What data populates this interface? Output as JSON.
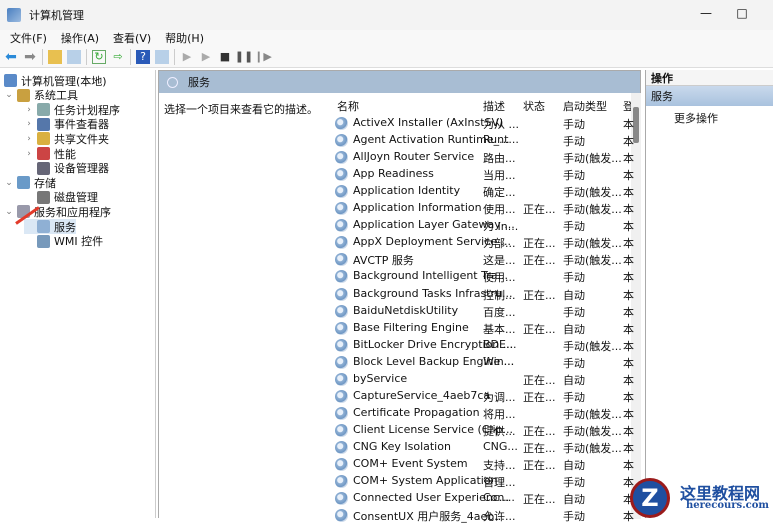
{
  "window": {
    "title": "计算机管理",
    "minimize": "—",
    "maximize": "□"
  },
  "menu": [
    "文件(F)",
    "操作(A)",
    "查看(V)",
    "帮助(H)"
  ],
  "tree": [
    {
      "label": "计算机管理(本地)",
      "level": 0,
      "chevron": "",
      "color": "#5a8ac8"
    },
    {
      "label": "系统工具",
      "level": 0,
      "chevron": "⌄",
      "color": "#c9a040"
    },
    {
      "label": "任务计划程序",
      "level": 1,
      "chevron": "›",
      "color": "#8aa"
    },
    {
      "label": "事件查看器",
      "level": 1,
      "chevron": "›",
      "color": "#5577aa"
    },
    {
      "label": "共享文件夹",
      "level": 1,
      "chevron": "›",
      "color": "#d9b040"
    },
    {
      "label": "性能",
      "level": 1,
      "chevron": "›",
      "color": "#c44"
    },
    {
      "label": "设备管理器",
      "level": 1,
      "chevron": "",
      "color": "#667"
    },
    {
      "label": "存储",
      "level": 0,
      "chevron": "⌄",
      "color": "#6a9ac8"
    },
    {
      "label": "磁盘管理",
      "level": 1,
      "chevron": "",
      "color": "#777"
    },
    {
      "label": "服务和应用程序",
      "level": 0,
      "chevron": "⌄",
      "color": "#99a"
    },
    {
      "label": "服务",
      "level": 1,
      "chevron": "",
      "color": "#8fb0d4",
      "selected": true
    },
    {
      "label": "WMI 控件",
      "level": 1,
      "chevron": "",
      "color": "#7799bb"
    }
  ],
  "middle": {
    "header": "服务",
    "description": "选择一个项目来查看它的描述。",
    "columns": [
      "名称",
      "描述",
      "状态",
      "启动类型",
      "登"
    ],
    "rows": [
      [
        "ActiveX Installer (AxInstSV)",
        "为从 ...",
        "",
        "手动",
        "本"
      ],
      [
        "Agent Activation Runtime_...",
        "Runt...",
        "",
        "手动",
        "本"
      ],
      [
        "AllJoyn Router Service",
        "路由...",
        "",
        "手动(触发...",
        "本"
      ],
      [
        "App Readiness",
        "当用...",
        "",
        "手动",
        "本"
      ],
      [
        "Application Identity",
        "确定...",
        "",
        "手动(触发...",
        "本"
      ],
      [
        "Application Information",
        "使用...",
        "正在...",
        "手动(触发...",
        "本"
      ],
      [
        "Application Layer Gateway ...",
        "为 In...",
        "",
        "手动",
        "本"
      ],
      [
        "AppX Deployment Service ...",
        "为部...",
        "正在...",
        "手动(触发...",
        "本"
      ],
      [
        "AVCTP 服务",
        "这是...",
        "正在...",
        "手动(触发...",
        "本"
      ],
      [
        "Background Intelligent Tra...",
        "使用...",
        "",
        "手动",
        "本"
      ],
      [
        "Background Tasks Infrastru...",
        "控制...",
        "正在...",
        "自动",
        "本"
      ],
      [
        "BaiduNetdiskUtility",
        "百度...",
        "",
        "手动",
        "本"
      ],
      [
        "Base Filtering Engine",
        "基本...",
        "正在...",
        "自动",
        "本"
      ],
      [
        "BitLocker Drive Encryption ...",
        "BDE...",
        "",
        "手动(触发...",
        "本"
      ],
      [
        "Block Level Backup Engine ...",
        "Win...",
        "",
        "手动",
        "本"
      ],
      [
        "byService",
        "",
        "正在...",
        "自动",
        "本"
      ],
      [
        "CaptureService_4aeb7ca",
        "为调...",
        "正在...",
        "手动",
        "本"
      ],
      [
        "Certificate Propagation",
        "将用...",
        "",
        "手动(触发...",
        "本"
      ],
      [
        "Client License Service (Clip...",
        "提供...",
        "正在...",
        "手动(触发...",
        "本"
      ],
      [
        "CNG Key Isolation",
        "CNG...",
        "正在...",
        "手动(触发...",
        "本"
      ],
      [
        "COM+ Event System",
        "支持...",
        "正在...",
        "自动",
        "本"
      ],
      [
        "COM+ System Application",
        "管理...",
        "",
        "手动",
        "本"
      ],
      [
        "Connected User Experienc...",
        "Con...",
        "正在...",
        "自动",
        "本"
      ],
      [
        "ConsentUX 用户服务_4aeb...",
        "允许...",
        "",
        "手动",
        "本"
      ]
    ]
  },
  "actions": {
    "header": "操作",
    "section": "服务",
    "more": "更多操作"
  },
  "watermark": {
    "title": "这里教程网",
    "url": "herecours.com"
  }
}
